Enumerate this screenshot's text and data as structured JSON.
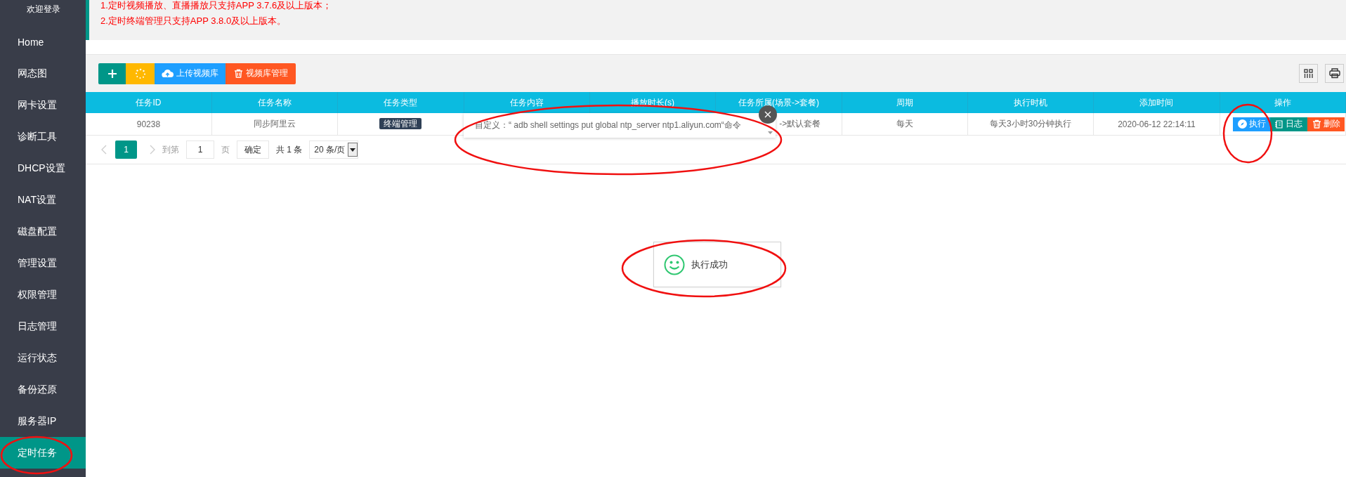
{
  "sidebar": {
    "header": "欢迎登录",
    "items": [
      {
        "label": "Home",
        "selected": false
      },
      {
        "label": "网态图",
        "selected": false
      },
      {
        "label": "网卡设置",
        "selected": false
      },
      {
        "label": "诊断工具",
        "selected": false
      },
      {
        "label": "DHCP设置",
        "selected": false
      },
      {
        "label": "NAT设置",
        "selected": false
      },
      {
        "label": "磁盘配置",
        "selected": false
      },
      {
        "label": "管理设置",
        "selected": false
      },
      {
        "label": "权限管理",
        "selected": false
      },
      {
        "label": "日志管理",
        "selected": false
      },
      {
        "label": "运行状态",
        "selected": false
      },
      {
        "label": "备份还原",
        "selected": false
      },
      {
        "label": "服务器IP",
        "selected": false
      },
      {
        "label": "定时任务",
        "selected": true
      }
    ]
  },
  "notices": [
    "1.定时视频播放、直播播放只支持APP 3.7.6及以上版本；",
    "2.定时终端管理只支持APP 3.8.0及以上版本。"
  ],
  "toolbar": {
    "buttons": [
      {
        "kind": "add"
      },
      {
        "kind": "loading"
      },
      {
        "kind": "upload",
        "label": "上传视频库"
      },
      {
        "kind": "manage",
        "label": "视频库管理"
      }
    ],
    "tools": [
      {
        "kind": "columns"
      },
      {
        "kind": "print"
      }
    ]
  },
  "table": {
    "columns": [
      "任务ID",
      "任务名称",
      "任务类型",
      "任务内容",
      "播放时长(s)",
      "任务所属(场景->套餐)",
      "周期",
      "执行时机",
      "添加时间",
      "操作"
    ],
    "rows": [
      {
        "id": "90238",
        "name": "同步阿里云",
        "type": "终端管理",
        "scene": "->默认套餐",
        "period": "每天",
        "timing": "每天3小时30分钟执行",
        "added": "2020-06-12 22:14:11",
        "actions": [
          {
            "kind": "run",
            "label": "执行"
          },
          {
            "kind": "log",
            "label": "日志"
          },
          {
            "kind": "delete",
            "label": "删除"
          }
        ]
      }
    ]
  },
  "popup": {
    "text": "自定义：“ adb shell settings put global ntp_server ntp1.aliyun.com“命令"
  },
  "pagination": {
    "current": "1",
    "goto_label": "到第",
    "page_value": "1",
    "page_unit": "页",
    "confirm": "确定",
    "total": "共 1 条",
    "page_size": "20 条/页"
  },
  "toast": {
    "text": "执行成功"
  }
}
